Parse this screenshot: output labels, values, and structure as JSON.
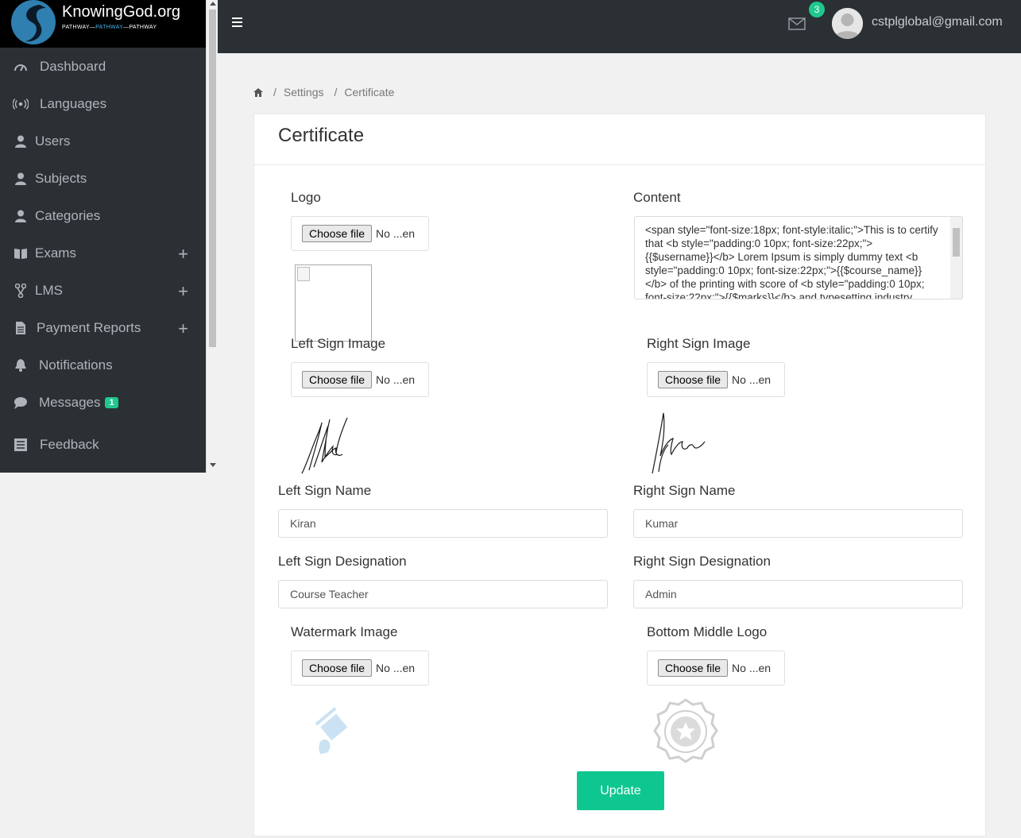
{
  "brand": {
    "title": "KnowingGod.org",
    "sub_left": "PATHWAY",
    "sub_mid": "PATHWAY",
    "sub_right": "PATHWAY"
  },
  "sidebar": {
    "items": [
      {
        "label": "Dashboard",
        "icon": "dashboard-icon"
      },
      {
        "label": "Languages",
        "icon": "broadcast-icon"
      },
      {
        "label": "Users",
        "icon": "user-icon"
      },
      {
        "label": "Subjects",
        "icon": "user-icon"
      },
      {
        "label": "Categories",
        "icon": "user-icon"
      },
      {
        "label": "Exams",
        "icon": "book-icon",
        "expandable": true
      },
      {
        "label": "LMS",
        "icon": "graph-icon",
        "expandable": true
      },
      {
        "label": "Payment Reports",
        "icon": "document-icon",
        "expandable": true
      },
      {
        "label": "Notifications",
        "icon": "bell-icon"
      },
      {
        "label": "Messages",
        "icon": "chat-icon",
        "badge": "1"
      },
      {
        "label": "Feedback",
        "icon": "list-icon"
      }
    ],
    "expand_symbol": "+"
  },
  "topbar": {
    "mail_count": "3",
    "user_email": "cstplglobal@gmail.com"
  },
  "breadcrumb": {
    "items": [
      "Settings",
      "Certificate"
    ],
    "separator": "/"
  },
  "card": {
    "title": "Certificate",
    "logo_label": "Logo",
    "content_label": "Content",
    "content_value": "<span style=\"font-size:18px; font-style:italic;\">This is to certify that <b style=\"padding:0 10px; font-size:22px;\">{{$username}}</b> Lorem Ipsum is simply dummy text <b style=\"padding:0 10px; font-size:22px;\">{{$course_name}}</b> of the printing with score of <b style=\"padding:0 10px; font-size:22px;\">{{$marks}}</b> and typesetting industry",
    "file_button": "Choose file",
    "file_status": "No ...en",
    "left_sign_image_label": "Left Sign Image",
    "right_sign_image_label": "Right Sign Image",
    "left_sign_name_label": "Left Sign Name",
    "left_sign_name_value": "Kiran",
    "right_sign_name_label": "Right Sign Name",
    "right_sign_name_value": "Kumar",
    "left_sign_designation_label": "Left Sign Designation",
    "left_sign_designation_value": "Course Teacher",
    "right_sign_designation_label": "Right Sign Designation",
    "right_sign_designation_value": "Admin",
    "watermark_label": "Watermark Image",
    "bottom_logo_label": "Bottom Middle Logo",
    "update_button": "Update"
  },
  "colors": {
    "sidebar_bg": "#2b3034",
    "accent_green": "#0ec790"
  }
}
